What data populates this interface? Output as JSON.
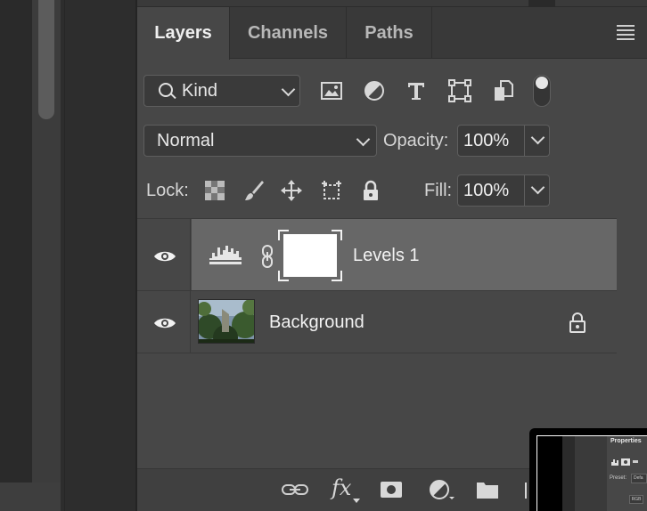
{
  "tabs": [
    {
      "label": "Layers",
      "active": true
    },
    {
      "label": "Channels",
      "active": false
    },
    {
      "label": "Paths",
      "active": false
    }
  ],
  "filter": {
    "kind_label": "Kind",
    "icons": [
      "image-filter-icon",
      "adjustment-filter-icon",
      "type-filter-icon",
      "shape-filter-icon",
      "smart-object-filter-icon"
    ]
  },
  "blend": {
    "mode": "Normal",
    "opacity_label": "Opacity:",
    "opacity_value": "100%"
  },
  "lock": {
    "label": "Lock:",
    "icons": [
      "lock-transparent-pixels-icon",
      "lock-image-pixels-icon",
      "lock-position-icon",
      "lock-artboard-icon",
      "lock-all-icon"
    ],
    "fill_label": "Fill:",
    "fill_value": "100%"
  },
  "layers": [
    {
      "name": "Levels 1",
      "visible": true,
      "selected": true,
      "type": "adjustment"
    },
    {
      "name": "Background",
      "visible": true,
      "selected": false,
      "locked": true
    }
  ],
  "footer_icons": [
    "link-layers-icon",
    "fx-icon",
    "add-mask-icon",
    "new-adjustment-icon",
    "new-group-icon",
    "new-layer-icon"
  ],
  "footer_fx_label": "fx",
  "properties_preview": {
    "title": "Properties",
    "preset_label": "Preset:",
    "preset_value": "Defa",
    "channel": "RGB"
  },
  "colors": {
    "panel_bg": "#474747",
    "selected_row": "#676767",
    "tab_bar": "#393939"
  }
}
